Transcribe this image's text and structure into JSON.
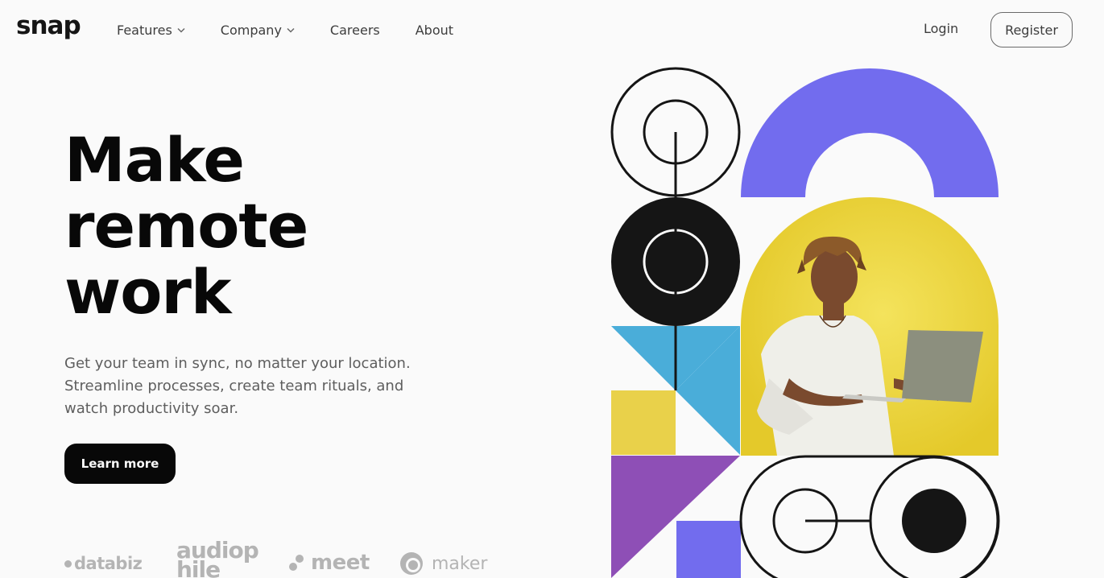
{
  "header": {
    "logo": "snap",
    "nav": [
      {
        "label": "Features",
        "has_dropdown": true
      },
      {
        "label": "Company",
        "has_dropdown": true
      },
      {
        "label": "Careers",
        "has_dropdown": false
      },
      {
        "label": "About",
        "has_dropdown": false
      }
    ],
    "login_label": "Login",
    "register_label": "Register"
  },
  "hero": {
    "headline_lines": [
      "Make",
      "remote",
      "work"
    ],
    "description_lines": [
      "Get your team in sync, no matter your location.",
      "Streamline processes, create team rituals, and",
      "watch productivity soar."
    ],
    "cta_label": "Learn more"
  },
  "clients": [
    "databiz",
    "audiophile",
    "meet",
    "maker"
  ],
  "colors": {
    "ink": "#151515",
    "violet": "#726cee",
    "yellow": "#e9d14a",
    "sky": "#4aadd9",
    "purple": "#8e4fb6",
    "muted": "#b4b4b4"
  },
  "icons": [
    "chevron-down-icon",
    "photo-of-man-with-laptop",
    "maker-icon",
    "meet-icon"
  ]
}
